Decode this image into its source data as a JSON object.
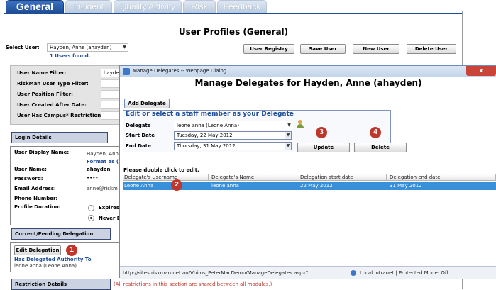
{
  "tabs": [
    "General",
    "Incident",
    "Quality Activity",
    "Risk",
    "Feedback"
  ],
  "page": {
    "title": "User Profiles (General)",
    "select_user_label": "Select User:",
    "select_user_value": "Hayden, Anne (ahayden)",
    "users_found": "1 Users found.",
    "buttons": [
      "User Registry",
      "Save User",
      "New User",
      "Delete User"
    ]
  },
  "filters": {
    "items": [
      "User Name Filter:",
      "RiskMan User Type Filter:",
      "User Position Filter:",
      "User Created After Date:",
      "User Has Campus* Restriction:"
    ],
    "name_value": "hayde"
  },
  "login": {
    "header": "Login Details",
    "display_name_label": "User Display Name:",
    "display_name_value": "Hayden, Ann",
    "format_text": "Format as (l",
    "username_label": "User Name:",
    "username_value": "ahayden",
    "password_label": "Password:",
    "password_value": "••••",
    "email_label": "Email Address:",
    "email_value": "anne@riskm",
    "phone_label": "Phone Number:",
    "profile_label": "Profile Duration:",
    "expires_text": "Expires",
    "never_text": "Never E"
  },
  "delegation": {
    "header": "Current/Pending Delegation",
    "edit_button": "Edit Delegation",
    "has_delegated": "Has Delegated Authority To",
    "delegate_name": "leone anna (Leone Anna)"
  },
  "restriction": {
    "header": "Restriction Details",
    "note": "(All restrictions in this section are shared between all modules.)"
  },
  "dialog": {
    "window_title": "Manage Delegates -- Webpage Dialog",
    "close_glyph": "x",
    "heading": "Manage Delegates for Hayden, Anne (ahayden)",
    "add_button": "Add Delegate",
    "edit_title": "Edit or select a staff member as your Delegate",
    "delegate_label": "Delegate",
    "delegate_value": "leone anna (Leone Anna)",
    "start_label": "Start Date",
    "start_value": "Tuesday, 22 May 2012",
    "end_label": "End Date",
    "end_value": "Thursday, 31 May 2012",
    "update_button": "Update",
    "delete_button": "Delete",
    "hint": "Please double click to edit.",
    "columns": [
      "Delegate's Username",
      "Delegate's Name",
      "Delegation start date",
      "Delegation end date"
    ],
    "row": [
      "Leone Anna",
      "leone anna",
      "22 May 2012",
      "31 May 2012"
    ],
    "status_url": "http://sites.riskman.net.au/Vhims_PeterMacDemo/ManageDelegates.aspx?",
    "status_zone": "Local intranet | Protected Mode: Off"
  },
  "markers": [
    "1",
    "2",
    "3",
    "4"
  ],
  "colors": {
    "tab_active": "#1f4e96",
    "selected_row": "#3a8fd9",
    "marker": "#c1362b",
    "section_header": "#cbd3e3"
  }
}
